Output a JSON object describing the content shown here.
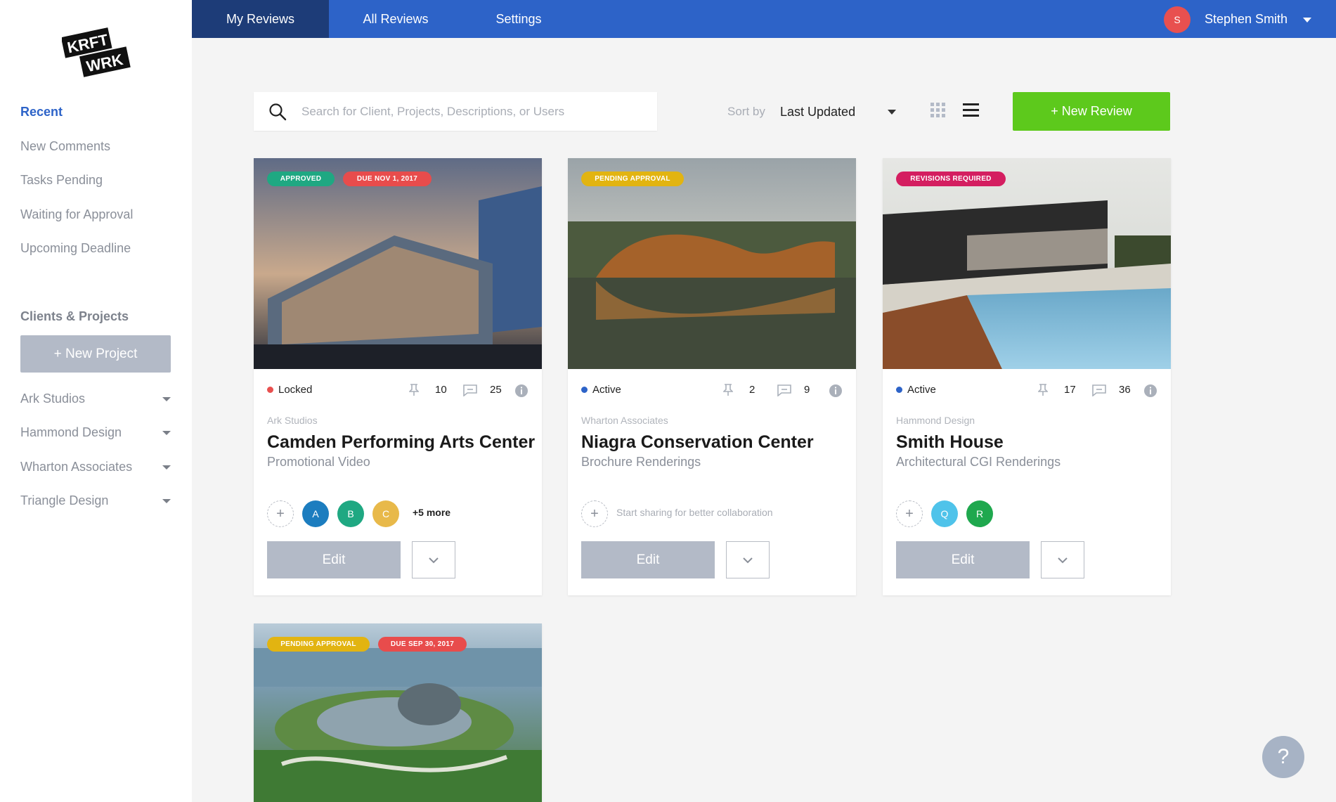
{
  "logo": {
    "line1": "KRFT",
    "line2": "WRK"
  },
  "sidebar": {
    "recent_label": "Recent",
    "links": [
      "New Comments",
      "Tasks Pending",
      "Waiting for Approval",
      "Upcoming Deadline"
    ],
    "clients_heading": "Clients & Projects",
    "new_project": "+  New Project",
    "clients": [
      "Ark Studios",
      "Hammond Design",
      "Wharton Associates",
      "Triangle Design"
    ]
  },
  "topbar": {
    "tabs": [
      "My Reviews",
      "All Reviews",
      "Settings"
    ],
    "active_tab": "My Reviews",
    "user_initial": "S",
    "user_name": "Stephen Smith"
  },
  "toolbar": {
    "search_placeholder": "Search for Client, Projects, Descriptions, or Users",
    "sort_label": "Sort by",
    "sort_value": "Last Updated",
    "new_review": "+  New Review"
  },
  "cards": [
    {
      "badges": [
        "APPROVED",
        "DUE NOV 1, 2017"
      ],
      "status": "Locked",
      "pins": "10",
      "comments": "25",
      "client": "Ark Studios",
      "title": "Camden Performing Arts Center",
      "subtitle": "Promotional Video",
      "avatars": [
        "A",
        "B",
        "C"
      ],
      "more": "+5 more",
      "edit": "Edit"
    },
    {
      "badges": [
        "PENDING APPROVAL"
      ],
      "status": "Active",
      "pins": "2",
      "comments": "9",
      "client": "Wharton Associates",
      "title": "Niagra Conservation Center",
      "subtitle": "Brochure Renderings",
      "share": "Start sharing for better collaboration",
      "edit": "Edit"
    },
    {
      "badges": [
        "REVISIONS REQUIRED"
      ],
      "status": "Active",
      "pins": "17",
      "comments": "36",
      "client": "Hammond Design",
      "title": "Smith House",
      "subtitle": "Architectural CGI Renderings",
      "avatars": [
        "Q",
        "R"
      ],
      "edit": "Edit"
    },
    {
      "badges": [
        "PENDING APPROVAL",
        "DUE SEP 30, 2017"
      ]
    }
  ],
  "help": "?",
  "colors": {
    "primary": "#2d63c8",
    "primary_dark": "#1d3c78",
    "new_review": "#5dc91c",
    "approved": "#1fa882",
    "due": "#e84c4c",
    "pending": "#e2b411",
    "revisions": "#d41e60",
    "locked_dot": "#e8504f",
    "active_dot": "#2d63c8"
  },
  "icons": [
    "search-icon",
    "grid-view-icon",
    "list-view-icon",
    "pin-icon",
    "comment-icon",
    "info-icon",
    "chevron-down-icon",
    "plus-icon"
  ]
}
